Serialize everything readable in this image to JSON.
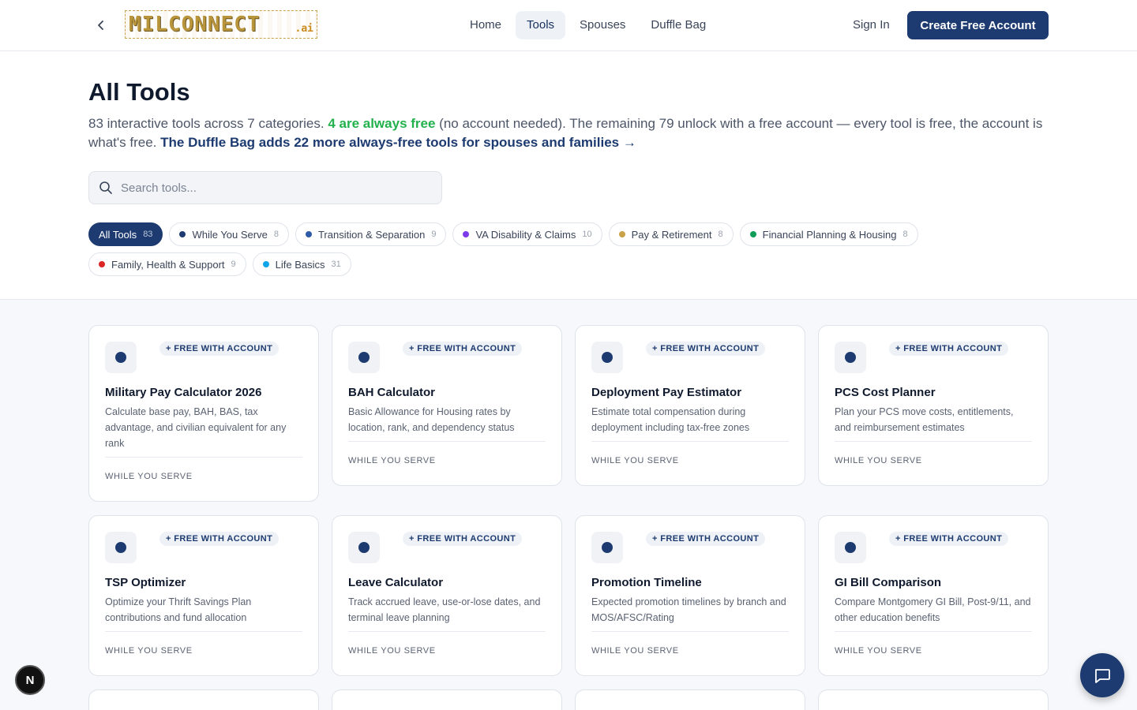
{
  "header": {
    "logo_text": "MILCONNECT",
    "logo_suffix": ".ai",
    "nav": [
      "Home",
      "Tools",
      "Spouses",
      "Duffle Bag"
    ],
    "active_nav": "Tools",
    "signin_label": "Sign In",
    "cta_label": "Create Free Account"
  },
  "hero": {
    "title": "All Tools",
    "intro_1": "83 interactive tools across 7 categories. ",
    "intro_green": "4 are always free",
    "intro_2": " (no account needed). The remaining 79 unlock with a free account — every tool is free, the account is what's free. ",
    "intro_link": "The Duffle Bag adds 22 more always-free tools for spouses and families →",
    "search_placeholder": "Search tools..."
  },
  "filters": [
    {
      "label": "All Tools",
      "count": "83",
      "color": "",
      "active": true
    },
    {
      "label": "While You Serve",
      "count": "8",
      "color": "#1d3b70"
    },
    {
      "label": "Transition & Separation",
      "count": "9",
      "color": "#2f5aa8"
    },
    {
      "label": "VA Disability & Claims",
      "count": "10",
      "color": "#7c3aed"
    },
    {
      "label": "Pay & Retirement",
      "count": "8",
      "color": "#c9a24a"
    },
    {
      "label": "Financial Planning & Housing",
      "count": "8",
      "color": "#0f9d58"
    },
    {
      "label": "Family, Health & Support",
      "count": "9",
      "color": "#dc2626"
    },
    {
      "label": "Life Basics",
      "count": "31",
      "color": "#0ea5e9"
    }
  ],
  "badge_label": "+ FREE WITH ACCOUNT",
  "cards": [
    {
      "title": "Military Pay Calculator 2026",
      "desc": "Calculate base pay, BAH, BAS, tax advantage, and civilian equivalent for any rank",
      "category": "WHILE YOU SERVE",
      "lines": 3
    },
    {
      "title": "BAH Calculator",
      "desc": "Basic Allowance for Housing rates by location, rank, and dependency status",
      "category": "WHILE YOU SERVE",
      "lines": 2
    },
    {
      "title": "Deployment Pay Estimator",
      "desc": "Estimate total compensation during deployment including tax-free zones",
      "category": "WHILE YOU SERVE",
      "lines": 2
    },
    {
      "title": "PCS Cost Planner",
      "desc": "Plan your PCS move costs, entitlements, and reimbursement estimates",
      "category": "WHILE YOU SERVE",
      "lines": 2
    },
    {
      "title": "TSP Optimizer",
      "desc": "Optimize your Thrift Savings Plan contributions and fund allocation",
      "category": "WHILE YOU SERVE",
      "lines": 2
    },
    {
      "title": "Leave Calculator",
      "desc": "Track accrued leave, use-or-lose dates, and terminal leave planning",
      "category": "WHILE YOU SERVE",
      "lines": 2
    },
    {
      "title": "Promotion Timeline",
      "desc": "Expected promotion timelines by branch and MOS/AFSC/Rating",
      "category": "WHILE YOU SERVE",
      "lines": 2
    },
    {
      "title": "GI Bill Comparison",
      "desc": "Compare Montgomery GI Bill, Post-9/11, and other education benefits",
      "category": "WHILE YOU SERVE",
      "lines": 2
    }
  ],
  "floating": {
    "n_badge": "N"
  },
  "colors": {
    "primary": "#1d3b70",
    "green": "#22b14c",
    "gold": "#c9a24a"
  }
}
